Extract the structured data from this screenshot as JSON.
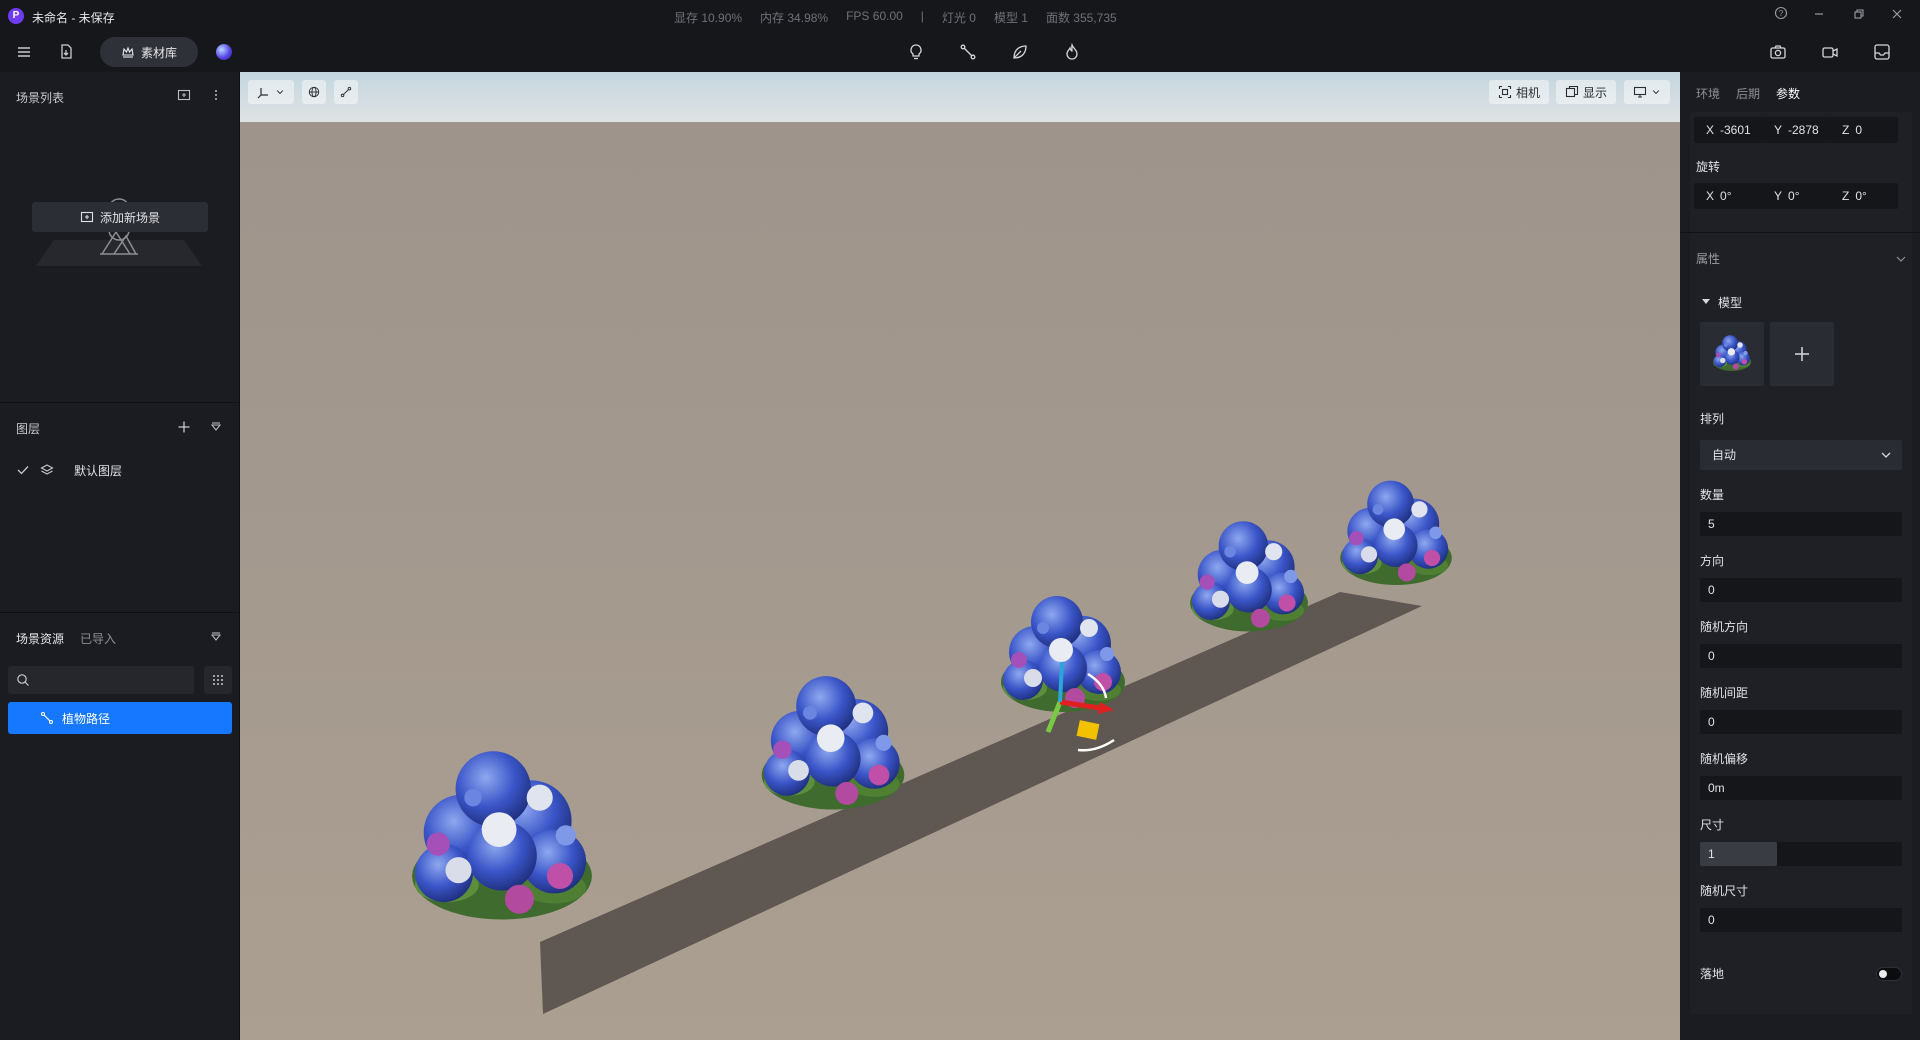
{
  "app": {
    "title": "未命名 - 未保存",
    "logo_letter": "P"
  },
  "stats": {
    "vram": "显存 10.90%",
    "memory": "内存 34.98%",
    "fps": "FPS 60.00",
    "separator": "|",
    "lights": "灯光 0",
    "models": "模型 1",
    "faces": "面数 355,735"
  },
  "toolbar": {
    "material_library": "素材库"
  },
  "left_panel": {
    "scene_list_title": "场景列表",
    "add_scene": "添加新场景",
    "layers_title": "图层",
    "default_layer": "默认图层",
    "assets_tab_scene": "场景资源",
    "assets_tab_imported": "已导入",
    "search_placeholder": "",
    "asset_items": [
      "植物路径"
    ]
  },
  "viewport": {
    "camera_label": "相机",
    "display_label": "显示"
  },
  "right_panel": {
    "tabs": [
      "环境",
      "后期",
      "参数"
    ],
    "active_tab": "参数",
    "position": {
      "x": "-3601",
      "y": "-2878",
      "z": "0"
    },
    "rotation_label": "旋转",
    "rotation": {
      "x": "0°",
      "y": "0°",
      "z": "0°"
    },
    "properties_label": "属性",
    "model_label": "模型",
    "arrange_label": "排列",
    "arrange_value": "自动",
    "count_label": "数量",
    "count_value": "5",
    "direction_label": "方向",
    "direction_value": "0",
    "random_direction_label": "随机方向",
    "random_direction_value": "0",
    "random_spacing_label": "随机间距",
    "random_spacing_value": "0",
    "random_offset_label": "随机偏移",
    "random_offset_value": "0m",
    "size_label": "尺寸",
    "size_value": "1",
    "size_slider_fraction": 0.38,
    "random_size_label": "随机尺寸",
    "random_size_value": "0",
    "ground_label": "落地",
    "ground_enabled": false
  },
  "icons": {
    "axis_x": "X",
    "axis_y": "Y",
    "axis_z": "Z"
  },
  "colors": {
    "accent": "#1677ff",
    "ground": "#a79c8f",
    "path": "#5e5750",
    "sky": "#cfdbe2"
  }
}
